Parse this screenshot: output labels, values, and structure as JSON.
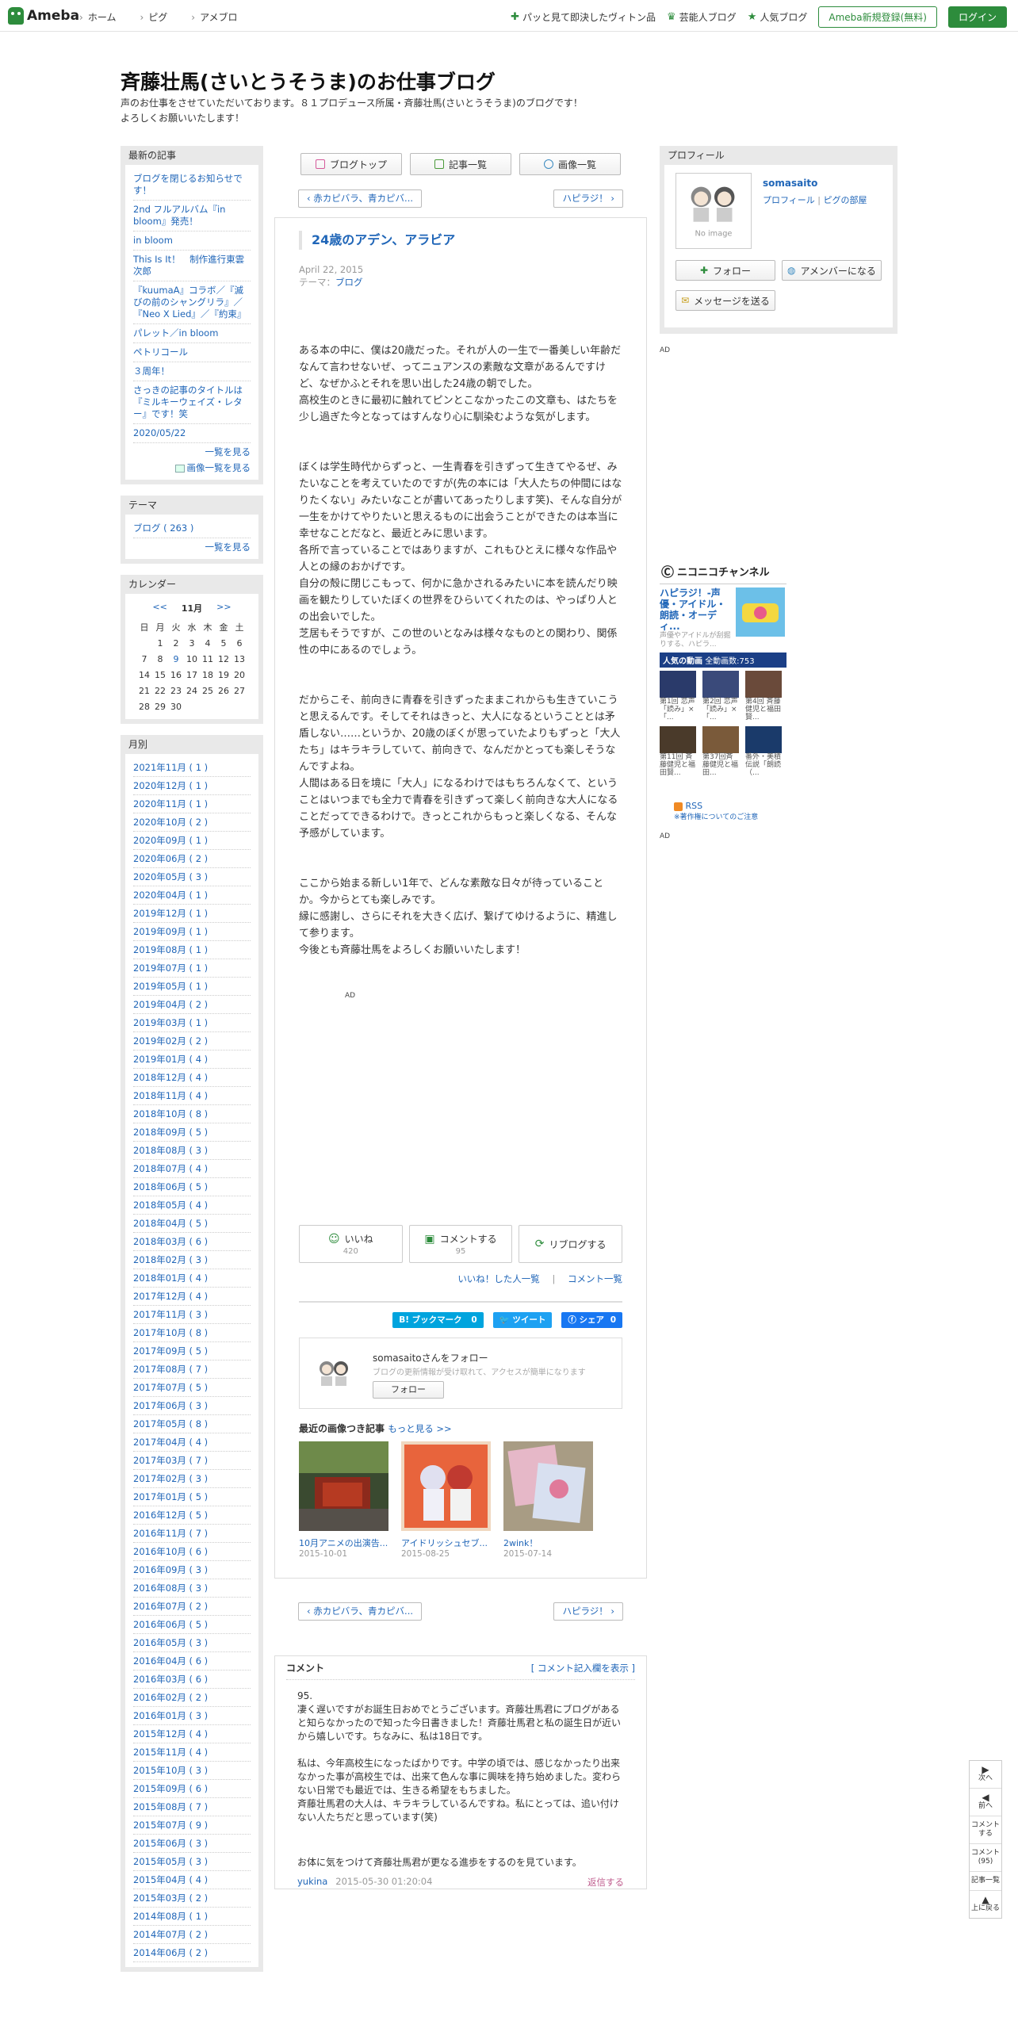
{
  "header": {
    "logo": "Ameba",
    "nav": [
      "ホーム",
      "ピグ",
      "アメブロ"
    ],
    "links": [
      "パッと見て即決したヴィトン品",
      "芸能人ブログ",
      "人気ブログ"
    ],
    "register": "Ameba新規登録(無料)",
    "login": "ログイン"
  },
  "blog": {
    "title": "斉藤壮馬(さいとうそうま)のお仕事ブログ",
    "desc1": "声のお仕事をさせていただいております。８１プロデュース所属・斉藤壮馬(さいとうそうま)のブログです！",
    "desc2": "よろしくお願いいたします！"
  },
  "sidebar": {
    "latest_title": "最新の記事",
    "latest": [
      "ブログを閉じるお知らせです！",
      "2nd フルアルバム『in bloom』発売！",
      "in bloom",
      "This Is It！　制作進行東雲次郎",
      "『kuumaA』コラボ／『滅びの前のシャングリラ』／『Neo X Lied』／『約束』",
      "パレット／in bloom",
      "ペトリコール",
      "３周年！",
      "さっきの記事のタイトルは『ミルキーウェイズ・レター』です！笑",
      "2020/05/22"
    ],
    "latest_more": "一覧を見る",
    "latest_img_more": "画像一覧を見る",
    "theme_title": "テーマ",
    "theme_item": "ブログ ( 263 )",
    "theme_more": "一覧を見る",
    "calendar_title": "カレンダー",
    "cal_prev": "<<",
    "cal_month": "11月",
    "cal_next": ">>",
    "cal_weekdays": [
      "日",
      "月",
      "火",
      "水",
      "木",
      "金",
      "土"
    ],
    "cal_rows": [
      [
        "",
        "1",
        "2",
        "3",
        "4",
        "5",
        "6"
      ],
      [
        "7",
        "8",
        "9",
        "10",
        "11",
        "12",
        "13"
      ],
      [
        "14",
        "15",
        "16",
        "17",
        "18",
        "19",
        "20"
      ],
      [
        "21",
        "22",
        "23",
        "24",
        "25",
        "26",
        "27"
      ],
      [
        "28",
        "29",
        "30",
        "",
        "",
        "",
        ""
      ]
    ],
    "cal_linked_day": "9",
    "monthly_title": "月別",
    "monthly": [
      "2021年11月 ( 1 )",
      "2020年12月 ( 1 )",
      "2020年11月 ( 1 )",
      "2020年10月 ( 2 )",
      "2020年09月 ( 1 )",
      "2020年06月 ( 2 )",
      "2020年05月 ( 3 )",
      "2020年04月 ( 1 )",
      "2019年12月 ( 1 )",
      "2019年09月 ( 1 )",
      "2019年08月 ( 1 )",
      "2019年07月 ( 1 )",
      "2019年05月 ( 1 )",
      "2019年04月 ( 2 )",
      "2019年03月 ( 1 )",
      "2019年02月 ( 2 )",
      "2019年01月 ( 4 )",
      "2018年12月 ( 4 )",
      "2018年11月 ( 4 )",
      "2018年10月 ( 8 )",
      "2018年09月 ( 5 )",
      "2018年08月 ( 3 )",
      "2018年07月 ( 4 )",
      "2018年06月 ( 5 )",
      "2018年05月 ( 4 )",
      "2018年04月 ( 5 )",
      "2018年03月 ( 6 )",
      "2018年02月 ( 3 )",
      "2018年01月 ( 4 )",
      "2017年12月 ( 4 )",
      "2017年11月 ( 3 )",
      "2017年10月 ( 8 )",
      "2017年09月 ( 5 )",
      "2017年08月 ( 7 )",
      "2017年07月 ( 5 )",
      "2017年06月 ( 3 )",
      "2017年05月 ( 8 )",
      "2017年04月 ( 4 )",
      "2017年03月 ( 7 )",
      "2017年02月 ( 3 )",
      "2017年01月 ( 5 )",
      "2016年12月 ( 5 )",
      "2016年11月 ( 7 )",
      "2016年10月 ( 6 )",
      "2016年09月 ( 3 )",
      "2016年08月 ( 3 )",
      "2016年07月 ( 2 )",
      "2016年06月 ( 5 )",
      "2016年05月 ( 3 )",
      "2016年04月 ( 6 )",
      "2016年03月 ( 6 )",
      "2016年02月 ( 2 )",
      "2016年01月 ( 3 )",
      "2015年12月 ( 4 )",
      "2015年11月 ( 4 )",
      "2015年10月 ( 3 )",
      "2015年09月 ( 6 )",
      "2015年08月 ( 7 )",
      "2015年07月 ( 9 )",
      "2015年06月 ( 3 )",
      "2015年05月 ( 3 )",
      "2015年04月 ( 4 )",
      "2015年03月 ( 2 )",
      "2014年08月 ( 1 )",
      "2014年07月 ( 2 )",
      "2014年06月 ( 2 )"
    ]
  },
  "tabs": [
    "ブログトップ",
    "記事一覧",
    "画像一覧"
  ],
  "pager": {
    "prev": "赤カピバラ、青カピバ...",
    "next": "ハピラジ！"
  },
  "article": {
    "title": "24歳のアデン、アラビア",
    "date": "April 22, 2015",
    "theme_label": "テーマ：",
    "theme": "ブログ",
    "paragraphs": [
      "ある本の中に、僕は20歳だった。それが人の一生で一番美しい年齢だなんて言わせないぜ、ってニュアンスの素敵な文章があるんですけど、なぜかふとそれを思い出した24歳の朝でした。\n高校生のときに最初に触れてピンとこなかったこの文章も、はたちを少し過ぎた今となってはすんなり心に馴染むような気がします。",
      "ぼくは学生時代からずっと、一生青春を引きずって生きてやるぜ、みたいなことを考えていたのですが(先の本には「大人たちの仲間にはなりたくない」みたいなことが書いてあったりします笑)、そんな自分が一生をかけてやりたいと思えるものに出会うことができたのは本当に幸せなことだなと、最近とみに思います。\n各所で言っていることではありますが、これもひとえに様々な作品や人との縁のおかげです。\n自分の殻に閉じこもって、何かに急かされるみたいに本を読んだり映画を観たりしていたぼくの世界をひらいてくれたのは、やっぱり人との出会いでした。\n芝居もそうですが、この世のいとなみは様々なものとの関わり、関係性の中にあるのでしょう。",
      "だからこそ、前向きに青春を引きずったままこれからも生きていこうと思えるんです。そしてそれはきっと、大人になるということとは矛盾しない……というか、20歳のぼくが思っていたよりもずっと「大人たち」はキラキラしていて、前向きで、なんだかとっても楽しそうなんですよね。\n人間はある日を境に「大人」になるわけではもちろんなくて、ということはいつまでも全力で青春を引きずって楽しく前向きな大人になることだってできるわけで。きっとこれからもっと楽しくなる、そんな予感がしています。",
      "ここから始まる新しい1年で、どんな素敵な日々が待っていることか。今からとても楽しみです。\n縁に感謝し、さらにそれを大きく広げ、繋げてゆけるように、精進して参ります。\n今後とも斉藤壮馬をよろしくお願いいたします！"
    ],
    "ad": "AD",
    "like_label": "いいね",
    "like_count": "420",
    "comment_label": "コメントする",
    "comment_count": "95",
    "reblog_label": "リブログする",
    "liked_link": "いいね！した人一覧",
    "sep": "|",
    "comment_link": "コメント一覧",
    "hatena": "B! ブックマーク",
    "hatena_count": "0",
    "tweet": "ツイート",
    "fb": "シェア",
    "fb_count": "0",
    "follow_title": "somasaitoさんをフォロー",
    "follow_desc": "ブログの更新情報が受け取れて、アクセスが簡単になります",
    "follow_btn": "フォロー",
    "recent_title": "最近の画像つき記事",
    "recent_more": "もっと見る >>",
    "recent": [
      {
        "title": "10月アニメの出演告...",
        "date": "2015-10-01"
      },
      {
        "title": "アイドリッシュセブ...",
        "date": "2015-08-25"
      },
      {
        "title": "2wink！",
        "date": "2015-07-14"
      }
    ]
  },
  "comments": {
    "title": "コメント",
    "toggle": "[ コメント記入欄を表示 ]",
    "num": "95.",
    "p1": "凄く遅いですがお誕生日おめでとうございます。斉藤壮馬君にブログがあると知らなかったので知った今日書きました！斉藤壮馬君と私の誕生日が近いから嬉しいです。ちなみに、私は18日です。",
    "p2": "私は、今年高校生になったばかりです。中学の頃では、感じなかったり出来なかった事が高校生では、出来て色んな事に興味を持ち始めました。変わらない日常でも最近では、生きる希望をもちました。\n斉藤壮馬君の大人は、キラキラしているんですね。私にとっては、追い付けない人たちだと思っています(笑)",
    "p3": "お体に気をつけて斉藤壮馬君が更なる進歩をするのを見ています。",
    "author": "yukina",
    "date": "2015-05-30 01:20:04",
    "reply": "返信する"
  },
  "profile": {
    "title": "プロフィール",
    "name": "somasaito",
    "link1": "プロフィール",
    "sep": "|",
    "link2": "ピグの部屋",
    "noimage": "No image",
    "follow": "フォロー",
    "member": "アメンバーになる",
    "message": "メッセージを送る"
  },
  "right": {
    "ad1": "AD",
    "nico_brand": "ニコニコチャンネル",
    "nico_title": "ハピラジ！-声優・アイドル・朗読・オーディ...",
    "nico_desc": "声優やアイドルが刮掘りする、ハピラ...",
    "nico_bar": "人気の動画",
    "nico_count": "全動画数:753",
    "videos": [
      "第1回 恋声「読み」×「...",
      "第2回 恋声「読み」×「...",
      "第4回 斉藤健児と福田賢...",
      "第11回 斉藤健児と福田賢...",
      "第37回斉藤健児と福田...",
      "番外・美積伝説「朗読（..."
    ],
    "rss": "RSS",
    "copyright": "※著作権についてのご注意",
    "ad2": "AD"
  },
  "float": [
    "次へ",
    "前へ",
    "コメントする",
    "コメント(95)",
    "記事一覧",
    "上に戻る"
  ],
  "colors": {
    "link": "#2066b8",
    "accent": "#2d8c3c",
    "hatena": "#00a4de",
    "twitter": "#1da1f2",
    "facebook": "#1877f2"
  }
}
